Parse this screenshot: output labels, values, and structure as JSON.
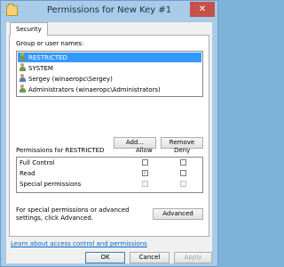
{
  "window": {
    "title": "Permissions for New Key #1",
    "close_glyph": "✕"
  },
  "tab": {
    "label": "Security"
  },
  "users": {
    "label": "Group or user names:",
    "items": [
      {
        "name": "RESTRICTED",
        "icon": "group-icon",
        "selected": true
      },
      {
        "name": "SYSTEM",
        "icon": "group-icon",
        "selected": false
      },
      {
        "name": "Sergey (winaeropc\\Sergey)",
        "icon": "user-icon",
        "selected": false
      },
      {
        "name": "Administrators (winaeropc\\Administrators)",
        "icon": "group-icon",
        "selected": false
      }
    ],
    "add_label": "Add...",
    "remove_label": "Remove"
  },
  "permissions": {
    "header": "Permissions for RESTRICTED",
    "allow_header": "Allow",
    "deny_header": "Deny",
    "rows": [
      {
        "name": "Full Control",
        "allow": false,
        "deny": false,
        "disabled": false
      },
      {
        "name": "Read",
        "allow": true,
        "deny": false,
        "disabled": false
      },
      {
        "name": "Special permissions",
        "allow": false,
        "deny": false,
        "disabled": true
      }
    ]
  },
  "advanced": {
    "text": "For special permissions or advanced settings, click Advanced.",
    "button_label": "Advanced"
  },
  "learn_link": "Learn about access control and permissions",
  "footer": {
    "ok_label": "OK",
    "cancel_label": "Cancel",
    "apply_label": "Apply"
  }
}
